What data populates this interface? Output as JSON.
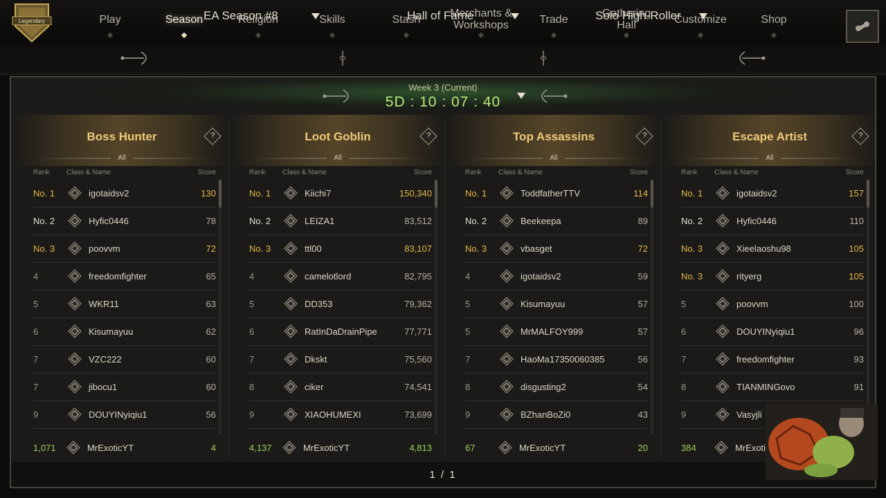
{
  "header": {
    "badge_label": "Legendary",
    "nav": [
      {
        "label": "Play",
        "active": false
      },
      {
        "label": "Season",
        "active": true
      },
      {
        "label": "Religion",
        "active": false
      },
      {
        "label": "Skills",
        "active": false
      },
      {
        "label": "Stash",
        "active": false
      },
      {
        "label": "Merchants &\nWorkshops",
        "active": false
      },
      {
        "label": "Trade",
        "active": false
      },
      {
        "label": "Gathering\nHall",
        "active": false
      },
      {
        "label": "Customize",
        "active": false
      },
      {
        "label": "Shop",
        "active": false
      }
    ],
    "settings_icon": "gear-icon"
  },
  "filters": {
    "season": "EA Season #8",
    "board": "Hall of Fame",
    "mode": "Solo High-Roller"
  },
  "week": {
    "label": "Week 3 (Current)",
    "timer": "5D : 10 : 07 : 40"
  },
  "table_headers": {
    "rank": "Rank",
    "name": "Class & Name",
    "score": "Score"
  },
  "all_label": "All",
  "help_label": "?",
  "columns": [
    {
      "title": "Boss Hunter",
      "rows": [
        {
          "rank": "No. 1",
          "name": "igotaidsv2",
          "score": "130",
          "tier": "gold"
        },
        {
          "rank": "No. 2",
          "name": "Hyfic0446",
          "score": "78",
          "tier": "silver"
        },
        {
          "rank": "No. 3",
          "name": "poovvm",
          "score": "72",
          "tier": "gold"
        },
        {
          "rank": "4",
          "name": "freedomfighter",
          "score": "65",
          "tier": ""
        },
        {
          "rank": "5",
          "name": "WKR11",
          "score": "63",
          "tier": ""
        },
        {
          "rank": "6",
          "name": "Kisumayuu",
          "score": "62",
          "tier": ""
        },
        {
          "rank": "7",
          "name": "VZC222",
          "score": "60",
          "tier": ""
        },
        {
          "rank": "7",
          "name": "jibocu1",
          "score": "60",
          "tier": ""
        },
        {
          "rank": "9",
          "name": "DOUYINyiqiu1",
          "score": "56",
          "tier": ""
        }
      ],
      "me": {
        "rank": "1,071",
        "name": "MrExoticYT",
        "score": "4"
      }
    },
    {
      "title": "Loot Goblin",
      "rows": [
        {
          "rank": "No. 1",
          "name": "Kiichi7",
          "score": "150,340",
          "tier": "gold"
        },
        {
          "rank": "No. 2",
          "name": "LEIZA1",
          "score": "83,512",
          "tier": "silver"
        },
        {
          "rank": "No. 3",
          "name": "ttl00",
          "score": "83,107",
          "tier": "gold"
        },
        {
          "rank": "4",
          "name": "camelotlord",
          "score": "82,795",
          "tier": ""
        },
        {
          "rank": "5",
          "name": "DD353",
          "score": "79,362",
          "tier": ""
        },
        {
          "rank": "6",
          "name": "RatInDaDrainPipe",
          "score": "77,771",
          "tier": ""
        },
        {
          "rank": "7",
          "name": "Dkskt",
          "score": "75,560",
          "tier": ""
        },
        {
          "rank": "8",
          "name": "ciker",
          "score": "74,541",
          "tier": ""
        },
        {
          "rank": "9",
          "name": "XIAOHUMEXI",
          "score": "73,699",
          "tier": ""
        }
      ],
      "me": {
        "rank": "4,137",
        "name": "MrExoticYT",
        "score": "4,813"
      }
    },
    {
      "title": "Top Assassins",
      "rows": [
        {
          "rank": "No. 1",
          "name": "ToddfatherTTV",
          "score": "114",
          "tier": "gold"
        },
        {
          "rank": "No. 2",
          "name": "Beekeepa",
          "score": "89",
          "tier": "silver"
        },
        {
          "rank": "No. 3",
          "name": "vbasget",
          "score": "72",
          "tier": "gold"
        },
        {
          "rank": "4",
          "name": "igotaidsv2",
          "score": "59",
          "tier": ""
        },
        {
          "rank": "5",
          "name": "Kisumayuu",
          "score": "57",
          "tier": ""
        },
        {
          "rank": "5",
          "name": "MrMALFOY999",
          "score": "57",
          "tier": ""
        },
        {
          "rank": "7",
          "name": "HaoMa17350060385",
          "score": "56",
          "tier": ""
        },
        {
          "rank": "8",
          "name": "disgusting2",
          "score": "54",
          "tier": ""
        },
        {
          "rank": "9",
          "name": "BZhanBoZi0",
          "score": "43",
          "tier": ""
        }
      ],
      "me": {
        "rank": "67",
        "name": "MrExoticYT",
        "score": "20"
      }
    },
    {
      "title": "Escape Artist",
      "rows": [
        {
          "rank": "No. 1",
          "name": "igotaidsv2",
          "score": "157",
          "tier": "gold"
        },
        {
          "rank": "No. 2",
          "name": "Hyfic0446",
          "score": "110",
          "tier": "silver"
        },
        {
          "rank": "No. 3",
          "name": "Xieelaoshu98",
          "score": "105",
          "tier": "gold"
        },
        {
          "rank": "No. 3",
          "name": "rityerg",
          "score": "105",
          "tier": "gold"
        },
        {
          "rank": "5",
          "name": "poovvm",
          "score": "100",
          "tier": ""
        },
        {
          "rank": "6",
          "name": "DOUYINyiqiu1",
          "score": "96",
          "tier": ""
        },
        {
          "rank": "7",
          "name": "freedomfighter",
          "score": "93",
          "tier": ""
        },
        {
          "rank": "8",
          "name": "TIANMINGovo",
          "score": "91",
          "tier": ""
        },
        {
          "rank": "9",
          "name": "Vasyjli",
          "score": "",
          "tier": ""
        }
      ],
      "me": {
        "rank": "384",
        "name": "MrExoti",
        "score": ""
      }
    }
  ],
  "pager": {
    "text": "1 / 1"
  },
  "colors": {
    "gold": "#e6b84a",
    "green": "#9ed05a",
    "accent": "#f0c878"
  }
}
